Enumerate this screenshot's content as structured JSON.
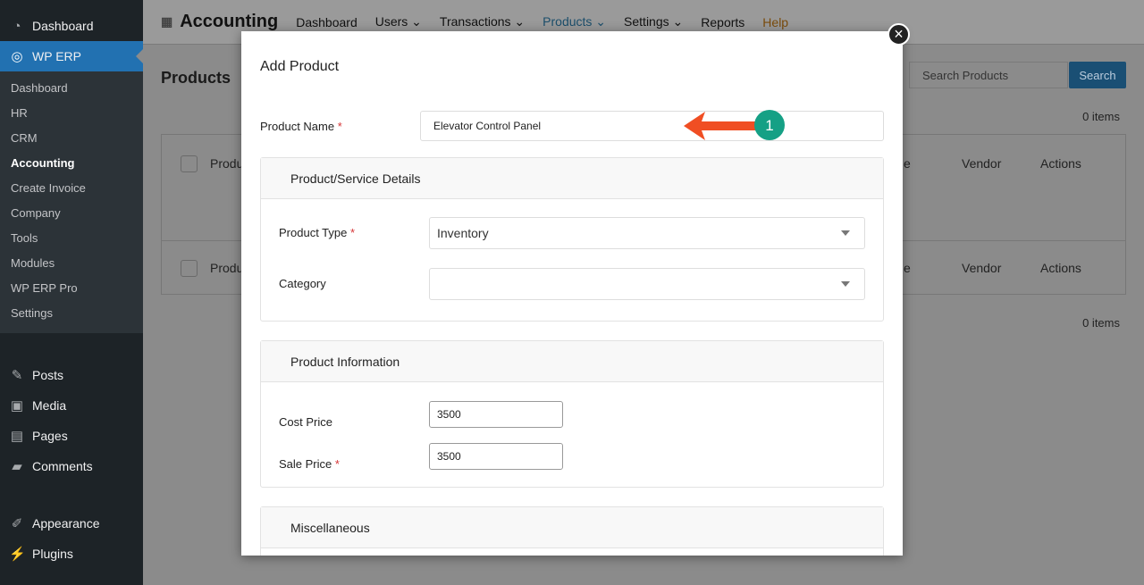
{
  "sidebar": {
    "top": [
      {
        "label": "Dashboard",
        "icon": "dashboard-icon"
      }
    ],
    "erp": "WP ERP",
    "sub": [
      "Dashboard",
      "HR",
      "CRM",
      "Accounting",
      "Create Invoice",
      "Company",
      "Tools",
      "Modules",
      "WP ERP Pro",
      "Settings"
    ],
    "current": "Accounting",
    "bottom": [
      {
        "label": "Posts",
        "icon": "pin-icon"
      },
      {
        "label": "Media",
        "icon": "media-icon"
      },
      {
        "label": "Pages",
        "icon": "pages-icon"
      },
      {
        "label": "Comments",
        "icon": "comment-icon"
      }
    ],
    "bottom2": [
      {
        "label": "Appearance",
        "icon": "brush-icon"
      },
      {
        "label": "Plugins",
        "icon": "plugin-icon"
      }
    ]
  },
  "topnav": {
    "title": "Accounting",
    "items": [
      "Dashboard",
      "Users",
      "Transactions",
      "Products",
      "Settings",
      "Reports",
      "Help"
    ]
  },
  "page": {
    "title": "Products",
    "search_placeholder": "Search Products",
    "search_btn": "Search",
    "items_count": "0 items",
    "columns": {
      "product": "Produ",
      "price": "e",
      "vendor": "Vendor",
      "actions": "Actions"
    }
  },
  "modal": {
    "title": "Add Product",
    "product_name_label": "Product Name",
    "product_name_value": "Elevator Control Panel",
    "annotation": "1",
    "details": {
      "header": "Product/Service Details",
      "type_label": "Product Type",
      "type_value": "Inventory",
      "category_label": "Category",
      "category_value": ""
    },
    "info": {
      "header": "Product Information",
      "cost_label": "Cost Price",
      "cost_value": "3500",
      "sale_label": "Sale Price",
      "sale_value": "3500"
    },
    "misc": {
      "header": "Miscellaneous"
    },
    "required_mark": "*"
  },
  "colors": {
    "accent": "#2271b1",
    "arrow": "#f04e23",
    "badge": "#15a085"
  }
}
